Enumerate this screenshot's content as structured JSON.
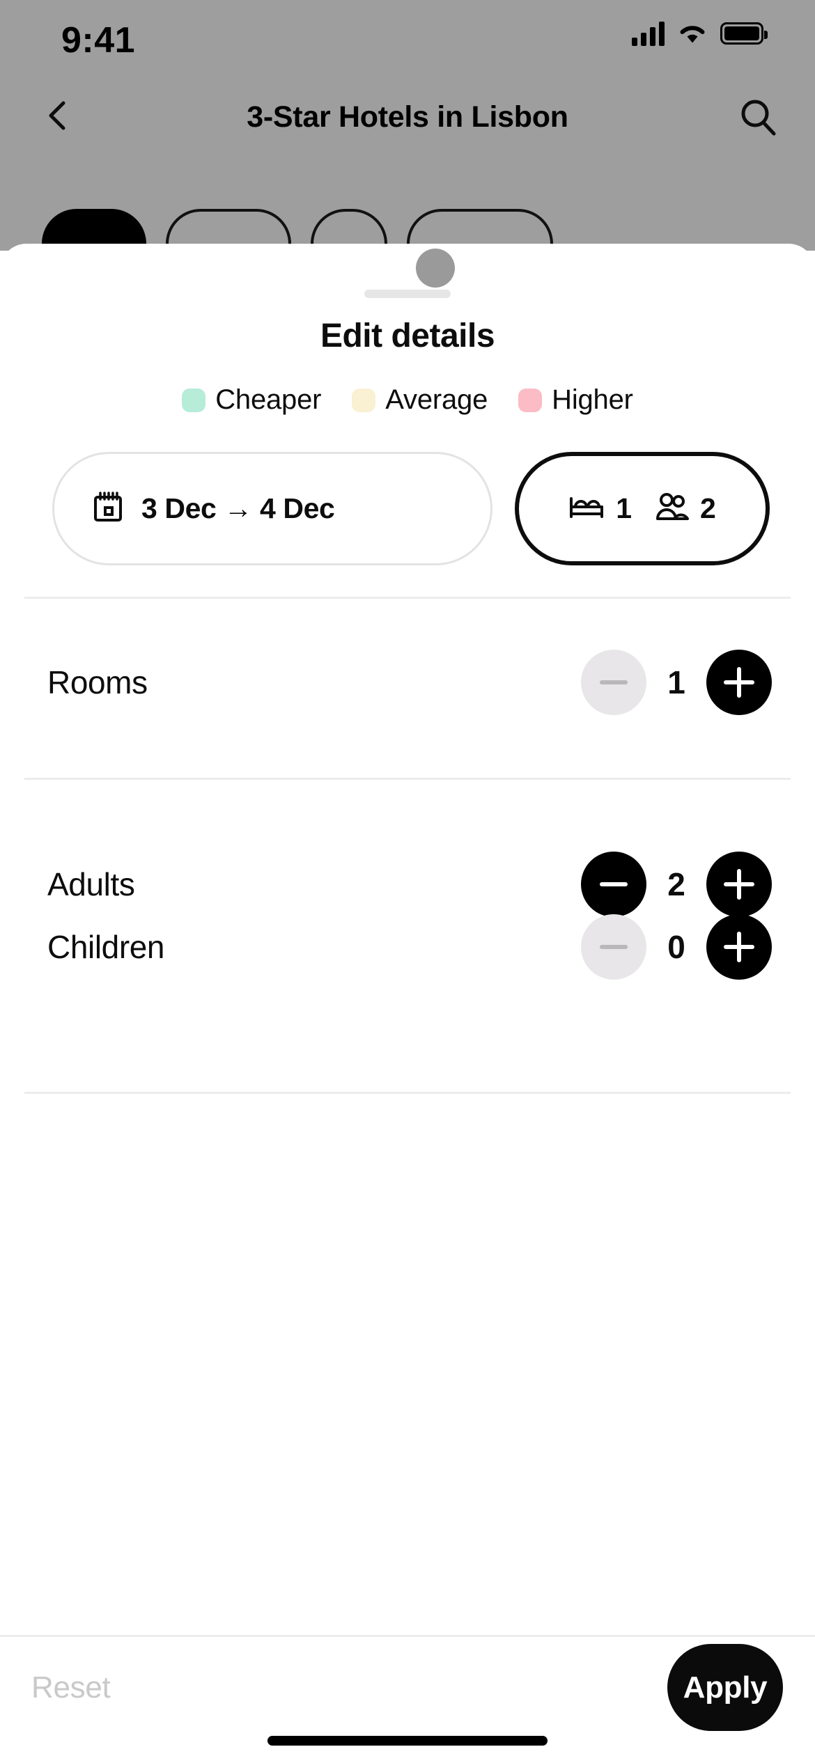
{
  "status_bar": {
    "time": "9:41",
    "cellular_icon": "cellular-signal-icon",
    "wifi_icon": "wifi-icon",
    "battery_icon": "battery-icon"
  },
  "nav_bar": {
    "back_icon": "chevron-left-icon",
    "title": "3-Star Hotels in Lisbon",
    "search_icon": "search-icon"
  },
  "filter_chips": [
    {
      "label": "",
      "selected": true
    },
    {
      "label": "",
      "selected": false
    },
    {
      "label": "",
      "selected": false
    },
    {
      "label": "",
      "selected": false
    }
  ],
  "sheet": {
    "drag_knob": "drag-knob",
    "grab_handle": "grab-handle",
    "title": "Edit details",
    "legend": [
      {
        "label": "Cheaper",
        "color": "#b6ecd8"
      },
      {
        "label": "Average",
        "color": "#faf0d2"
      },
      {
        "label": "Higher",
        "color": "#fbbcc5"
      }
    ],
    "date_pill": {
      "icon": "calendar-icon",
      "check_in": "3 Dec",
      "arrow": "→",
      "check_out": "4 Dec",
      "text": "3 Dec → 4 Dec"
    },
    "guests_pill": {
      "bed_icon": "bed-icon",
      "rooms_value": "1",
      "people_icon": "people-icon",
      "guests_value": "2",
      "selected": true
    },
    "steppers": [
      {
        "label": "Rooms",
        "value": "1",
        "decrement_icon": "minus-icon",
        "increment_icon": "plus-icon",
        "decrement_disabled": true
      },
      {
        "label": "Adults",
        "value": "2",
        "decrement_icon": "minus-icon",
        "increment_icon": "plus-icon",
        "decrement_disabled": false
      },
      {
        "label": "Children",
        "value": "0",
        "decrement_icon": "minus-icon",
        "increment_icon": "plus-icon",
        "decrement_disabled": true
      }
    ]
  },
  "footer": {
    "reset_label": "Reset",
    "apply_label": "Apply"
  },
  "colors": {
    "accent": "#000000",
    "backdrop": "#9e9e9e",
    "disabled_text": "#c9c9c9",
    "divider": "#ececec"
  }
}
